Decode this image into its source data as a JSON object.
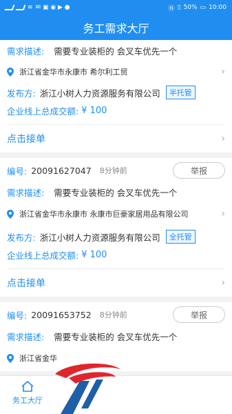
{
  "status": {
    "battery": "50%",
    "time": "10:00"
  },
  "header": {
    "title": "务工需求大厅"
  },
  "cards": [
    {
      "desc_label": "需求描述:",
      "desc": "需要专业装柜的 会叉车优先一个",
      "address": "浙江省金华市永康市 希尔利工贸",
      "publisher_label": "发布方:",
      "publisher": "浙江小树人力资源服务有限公司",
      "tag": "半托管",
      "deal_label": "企业线上总成交额:",
      "deal": "¥ 100",
      "grab": "点击接单"
    },
    {
      "code_label": "编号:",
      "code": "20091627047",
      "time": "8分钟前",
      "report": "举报",
      "desc_label": "需求描述:",
      "desc": "需要专业装柜的 会叉车优先一个",
      "address": "浙江省金华市永康市 永康市巨豪家居用品有限公司",
      "publisher_label": "发布方:",
      "publisher": "浙江小树人力资源服务有限公司",
      "tag": "全托管",
      "deal_label": "企业线上总成交额:",
      "deal": "¥ 100",
      "grab": "点击接单"
    },
    {
      "code_label": "编号:",
      "code": "20091653752",
      "time": "8分钟前",
      "report": "举报",
      "desc_label": "需求描述:",
      "desc": "需要专业装柜的 会叉车优先一个",
      "address": "浙江省金华"
    }
  ],
  "tabbar": {
    "tab_label": "务工大厅"
  },
  "colors": {
    "primary": "#1f8ef0"
  }
}
